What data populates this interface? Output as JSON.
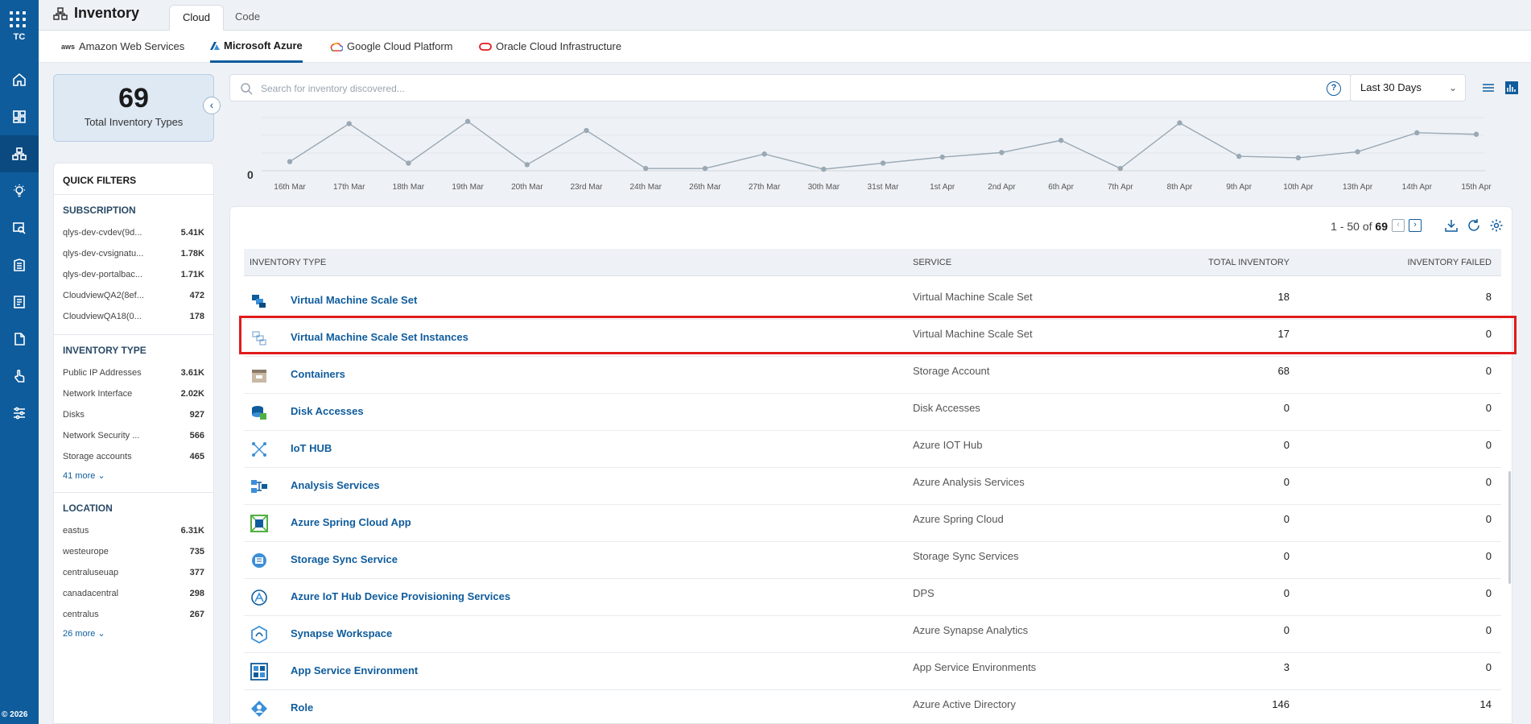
{
  "rail": {
    "initials": "TC",
    "copyright": "© 2026"
  },
  "header": {
    "title": "Inventory",
    "tabs": [
      {
        "label": "Cloud"
      },
      {
        "label": "Code"
      }
    ]
  },
  "providers": [
    {
      "label": "Amazon Web Services",
      "logo": "aws"
    },
    {
      "label": "Microsoft Azure"
    },
    {
      "label": "Google Cloud Platform"
    },
    {
      "label": "Oracle Cloud Infrastructure"
    }
  ],
  "summary": {
    "count": "69",
    "label": "Total Inventory Types"
  },
  "filters": {
    "title": "QUICK FILTERS",
    "subscription": {
      "title": "SUBSCRIPTION",
      "items": [
        {
          "label": "qlys-dev-cvdev(9d...",
          "value": "5.41K"
        },
        {
          "label": "qlys-dev-cvsignatu...",
          "value": "1.78K"
        },
        {
          "label": "qlys-dev-portalbac...",
          "value": "1.71K"
        },
        {
          "label": "CloudviewQA2(8ef...",
          "value": "472"
        },
        {
          "label": "CloudviewQA18(0...",
          "value": "178"
        }
      ]
    },
    "inventory_type": {
      "title": "INVENTORY TYPE",
      "items": [
        {
          "label": "Public IP Addresses",
          "value": "3.61K"
        },
        {
          "label": "Network Interface",
          "value": "2.02K"
        },
        {
          "label": "Disks",
          "value": "927"
        },
        {
          "label": "Network Security ...",
          "value": "566"
        },
        {
          "label": "Storage accounts",
          "value": "465"
        }
      ],
      "more": "41 more"
    },
    "location": {
      "title": "LOCATION",
      "items": [
        {
          "label": "eastus",
          "value": "6.31K"
        },
        {
          "label": "westeurope",
          "value": "735"
        },
        {
          "label": "centraluseuap",
          "value": "377"
        },
        {
          "label": "canadacentral",
          "value": "298"
        },
        {
          "label": "centralus",
          "value": "267"
        }
      ],
      "more": "26 more"
    }
  },
  "search": {
    "placeholder": "Search for inventory discovered...",
    "value": ""
  },
  "date_range": {
    "selected": "Last 30 Days"
  },
  "chart_data": {
    "type": "line",
    "x": [
      "16th Mar",
      "17th Mar",
      "18th Mar",
      "19th Mar",
      "20th Mar",
      "23rd Mar",
      "24th Mar",
      "26th Mar",
      "27th Mar",
      "30th Mar",
      "31st Mar",
      "1st Apr",
      "2nd Apr",
      "6th Apr",
      "7th Apr",
      "8th Apr",
      "9th Apr",
      "10th Apr",
      "13th Apr",
      "14th Apr",
      "15th Apr"
    ],
    "values": [
      12,
      62,
      10,
      65,
      8,
      53,
      3,
      3,
      22,
      2,
      10,
      18,
      24,
      40,
      3,
      63,
      19,
      17,
      25,
      50,
      48
    ],
    "y_tick_label": "0",
    "ylim": [
      0,
      70
    ],
    "grid": true,
    "color": "#9aa8b4"
  },
  "pagination": {
    "range": "1 - 50 of",
    "total": "69"
  },
  "table": {
    "headers": [
      "INVENTORY TYPE",
      "SERVICE",
      "TOTAL INVENTORY",
      "INVENTORY FAILED"
    ],
    "rows": [
      {
        "name": "Virtual Machine Scale Set",
        "service": "Virtual Machine Scale Set",
        "total": "18",
        "failed": "8",
        "icon": "vmss-icon"
      },
      {
        "name": "Virtual Machine Scale Set Instances",
        "service": "Virtual Machine Scale Set",
        "total": "17",
        "failed": "0",
        "icon": "vmss-instances-icon"
      },
      {
        "name": "Containers",
        "service": "Storage Account",
        "total": "68",
        "failed": "0",
        "icon": "container-icon"
      },
      {
        "name": "Disk Accesses",
        "service": "Disk Accesses",
        "total": "0",
        "failed": "0",
        "icon": "disk-access-icon"
      },
      {
        "name": "IoT HUB",
        "service": "Azure IOT Hub",
        "total": "0",
        "failed": "0",
        "icon": "iot-hub-icon"
      },
      {
        "name": "Analysis Services",
        "service": "Azure Analysis Services",
        "total": "0",
        "failed": "0",
        "icon": "analysis-services-icon"
      },
      {
        "name": "Azure Spring Cloud App",
        "service": "Azure Spring Cloud",
        "total": "0",
        "failed": "0",
        "icon": "spring-cloud-icon"
      },
      {
        "name": "Storage Sync Service",
        "service": "Storage Sync Services",
        "total": "0",
        "failed": "0",
        "icon": "storage-sync-icon"
      },
      {
        "name": "Azure IoT Hub Device Provisioning Services",
        "service": "DPS",
        "total": "0",
        "failed": "0",
        "icon": "dps-icon"
      },
      {
        "name": "Synapse Workspace",
        "service": "Azure Synapse Analytics",
        "total": "0",
        "failed": "0",
        "icon": "synapse-icon"
      },
      {
        "name": "App Service Environment",
        "service": "App Service Environments",
        "total": "3",
        "failed": "0",
        "icon": "app-service-env-icon"
      },
      {
        "name": "Role",
        "service": "Azure Active Directory",
        "total": "146",
        "failed": "14",
        "icon": "role-icon"
      }
    ]
  },
  "colors": {
    "brand": "#0f5c9c",
    "highlight": "#e01b1b",
    "link": "#0f5c9c"
  }
}
